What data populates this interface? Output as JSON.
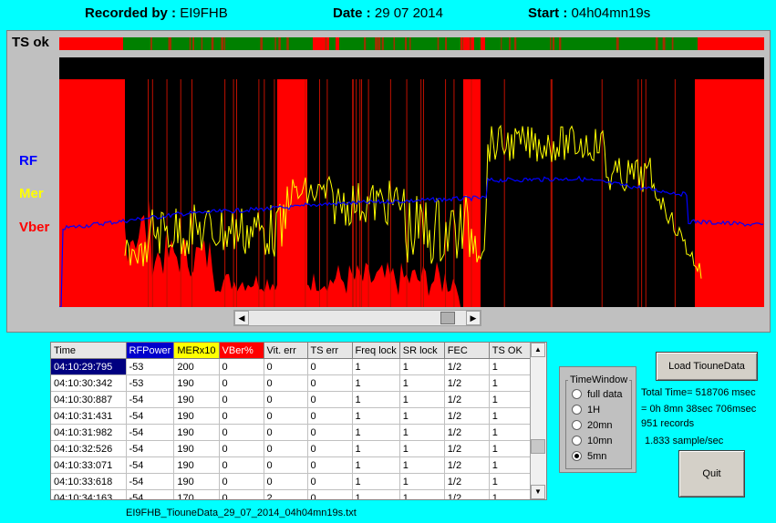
{
  "header": {
    "recorded_by_label": "Recorded by :",
    "recorded_by": "EI9FHB",
    "date_label": "Date :",
    "date": "29 07 2014",
    "start_label": "Start :",
    "start": "04h04mn19s"
  },
  "chart_data": {
    "type": "line",
    "ts_label": "TS ok",
    "series": [
      {
        "name": "RF",
        "color": "#0000ff"
      },
      {
        "name": "Mer",
        "color": "#ffff00"
      },
      {
        "name": "Vber",
        "color": "#ff0000"
      }
    ]
  },
  "table": {
    "columns": [
      "Time",
      "RFPower",
      "MERx10",
      "VBer%",
      "Vit. err",
      "TS err",
      "Freq lock",
      "SR lock",
      "FEC",
      "TS OK"
    ],
    "rows": [
      [
        "04:10:29:795",
        "-53",
        "200",
        "0",
        "0",
        "0",
        "1",
        "1",
        "1/2",
        "1"
      ],
      [
        "04:10:30:342",
        "-53",
        "190",
        "0",
        "0",
        "0",
        "1",
        "1",
        "1/2",
        "1"
      ],
      [
        "04:10:30:887",
        "-54",
        "190",
        "0",
        "0",
        "0",
        "1",
        "1",
        "1/2",
        "1"
      ],
      [
        "04:10:31:431",
        "-54",
        "190",
        "0",
        "0",
        "0",
        "1",
        "1",
        "1/2",
        "1"
      ],
      [
        "04:10:31:982",
        "-54",
        "190",
        "0",
        "0",
        "0",
        "1",
        "1",
        "1/2",
        "1"
      ],
      [
        "04:10:32:526",
        "-54",
        "190",
        "0",
        "0",
        "0",
        "1",
        "1",
        "1/2",
        "1"
      ],
      [
        "04:10:33:071",
        "-54",
        "190",
        "0",
        "0",
        "0",
        "1",
        "1",
        "1/2",
        "1"
      ],
      [
        "04:10:33:618",
        "-54",
        "190",
        "0",
        "0",
        "0",
        "1",
        "1",
        "1/2",
        "1"
      ],
      [
        "04:10:34:163",
        "-54",
        "170",
        "0",
        "2",
        "0",
        "1",
        "1",
        "1/2",
        "1"
      ]
    ]
  },
  "filename": "EI9FHB_TiouneData_29_07_2014_04h04mn19s.txt",
  "time_window": {
    "title": "TimeWindow",
    "options": [
      "full data",
      "1H",
      "20mn",
      "10mn",
      "5mn"
    ],
    "selected": "5mn"
  },
  "buttons": {
    "load": "Load TiouneData",
    "quit": "Quit"
  },
  "stats": {
    "total_time": "Total Time= 518706 msec",
    "duration": "= 0h 8mn 38sec 706msec",
    "records": "951 records",
    "rate": "1.833 sample/sec"
  },
  "colors": {
    "background": "#00ffff",
    "rf": "#0000ff",
    "mer": "#ffff00",
    "vber": "#ff0000",
    "ts_ok": "#008000",
    "ts_bad": "#ff0000"
  }
}
